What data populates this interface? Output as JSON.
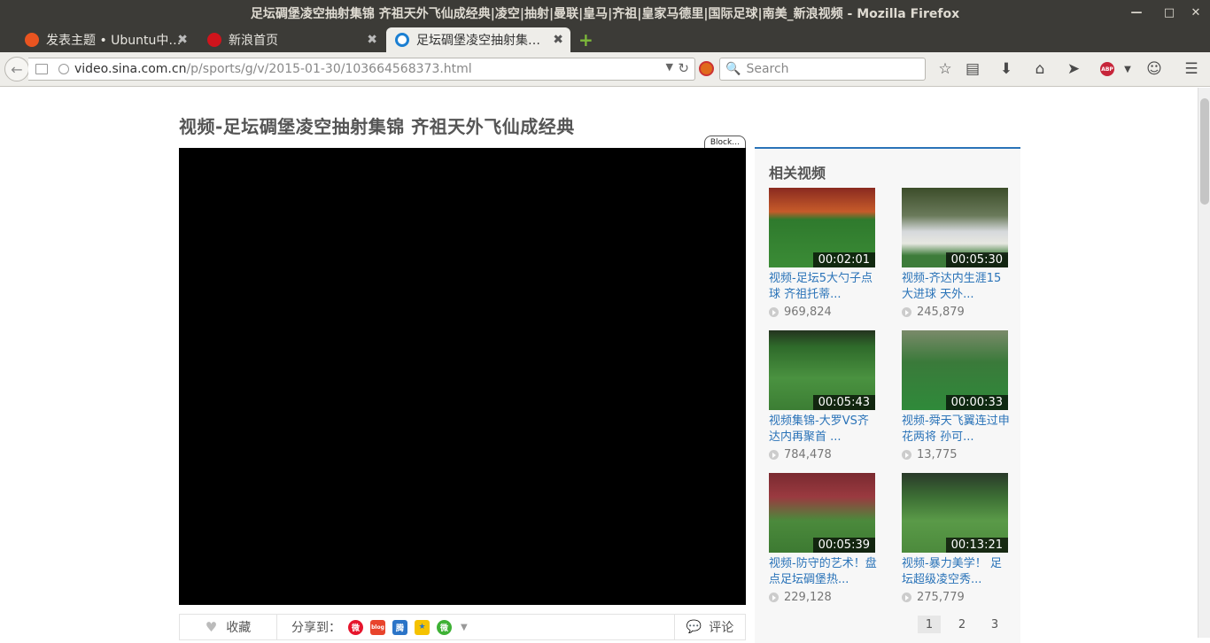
{
  "window": {
    "title": "足坛碉堡凌空抽射集锦 齐祖天外飞仙成经典|凌空|抽射|曼联|皇马|齐祖|皇家马德里|国际足球|南美_新浪视频 - Mozilla Firefox"
  },
  "tabs": [
    {
      "label": "发表主题 • Ubuntu中…",
      "close": "✖"
    },
    {
      "label": "新浪首页",
      "close": "✖"
    },
    {
      "label": "足坛碉堡凌空抽射集…",
      "close": "✖"
    }
  ],
  "nav": {
    "url_domain": "video.sina.com.cn",
    "url_path": "/p/sports/g/v/2015-01-30/103664568373.html",
    "search_placeholder": "Search"
  },
  "page": {
    "video_title": "视频-足坛碉堡凌空抽射集锦 齐祖天外飞仙成经典",
    "block_label": "Block…",
    "favorite_label": "收藏",
    "share_label": "分享到：",
    "comment_label": "评论",
    "share_icons": {
      "blog": "blog"
    }
  },
  "related": {
    "title": "相关视频",
    "items": [
      {
        "duration": "00:02:01",
        "title": "视频-足坛5大勺子点球 齐祖托蒂...",
        "views": "969,824"
      },
      {
        "duration": "00:05:30",
        "title": "视频-齐达内生涯15大进球 天外...",
        "views": "245,879"
      },
      {
        "duration": "00:05:43",
        "title": "视频集锦-大罗VS齐达内再聚首 ...",
        "views": "784,478"
      },
      {
        "duration": "00:00:33",
        "title": "视频-舜天飞翼连过申花两将 孙可...",
        "views": "13,775"
      },
      {
        "duration": "00:05:39",
        "title": "视频-防守的艺术！盘点足坛碉堡热...",
        "views": "229,128"
      },
      {
        "duration": "00:13:21",
        "title": "视频-暴力美学！ 足坛超级凌空秀...",
        "views": "275,779"
      }
    ],
    "pages": [
      "1",
      "2",
      "3"
    ]
  },
  "colors": {
    "accent": "#2a73b8",
    "titlebar": "#3c3b37"
  }
}
